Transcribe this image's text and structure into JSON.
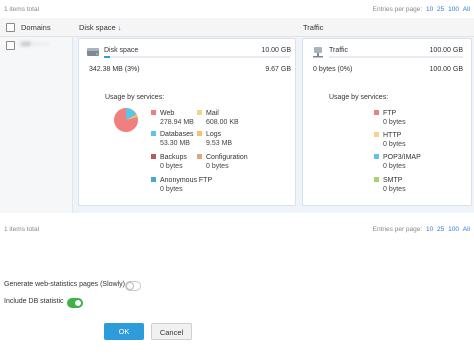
{
  "top": {
    "items_total": "1 items total",
    "entries_label": "Entries per page:",
    "entries_options": [
      "10",
      "25",
      "100",
      "All"
    ]
  },
  "table": {
    "col_domains": "Domains",
    "col_disk": "Disk space",
    "col_traffic": "Traffic",
    "row_domain": "cor········"
  },
  "disk": {
    "label": "Disk space",
    "total": "10.00 GB",
    "used": "342.38 MB (3%)",
    "free": "9.67 GB",
    "used_fraction": 0.03,
    "usage_title": "Usage by services:",
    "services": [
      {
        "name": "Web",
        "value": "278.94 MB",
        "color": "#f08080"
      },
      {
        "name": "Mail",
        "value": "608.00 KB",
        "color": "#f2d58a"
      },
      {
        "name": "Databases",
        "value": "53.30 MB",
        "color": "#5bc4e8"
      },
      {
        "name": "Logs",
        "value": "9.53 MB",
        "color": "#f2c36b"
      },
      {
        "name": "Backups",
        "value": "0 bytes",
        "color": "#b0605b"
      },
      {
        "name": "Configuration",
        "value": "0 bytes",
        "color": "#e0a878"
      },
      {
        "name": "Anonymous FTP",
        "value": "0 bytes",
        "color": "#4aa8c9"
      }
    ]
  },
  "traffic": {
    "label": "Traffic",
    "total": "100.00 GB",
    "used": "0 bytes (0%)",
    "free": "100.00 GB",
    "usage_title": "Usage by services:",
    "services": [
      {
        "name": "FTP",
        "value": "0 bytes",
        "color": "#f08080"
      },
      {
        "name": "HTTP",
        "value": "0 bytes",
        "color": "#f2d58a"
      },
      {
        "name": "POP3/IMAP",
        "value": "0 bytes",
        "color": "#5bc4e8"
      },
      {
        "name": "SMTP",
        "value": "0 bytes",
        "color": "#a4d66a"
      }
    ]
  },
  "bottom": {
    "items_total": "1 items total",
    "entries_label": "Entries per page:",
    "entries_options": [
      "10",
      "25",
      "100",
      "All"
    ]
  },
  "options": {
    "web_stats_label": "Generate web-statistics pages (Slowly)",
    "web_stats_on": false,
    "db_stat_label": "Include DB statistic",
    "db_stat_on": true
  },
  "buttons": {
    "ok": "OK",
    "cancel": "Cancel"
  }
}
